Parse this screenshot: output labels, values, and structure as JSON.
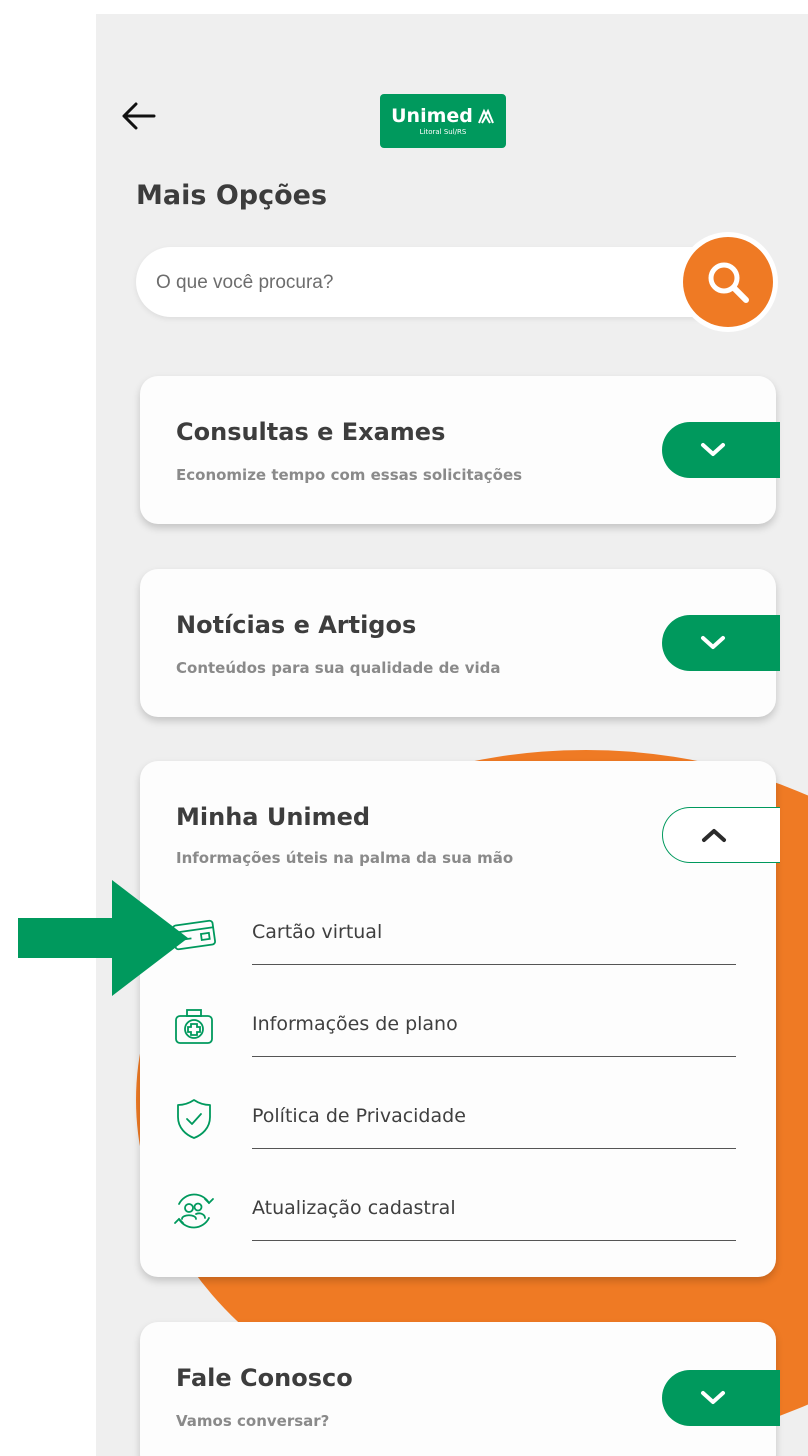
{
  "header": {
    "back_icon": "arrow-left-icon",
    "logo": {
      "name": "Unimed",
      "subtitle": "Litoral Sul/RS",
      "color": "#00995d"
    },
    "title": "Mais Opções"
  },
  "search": {
    "placeholder": "O que você procura?",
    "button_icon": "search-icon",
    "button_color": "#ef7a24"
  },
  "cards": [
    {
      "title": "Consultas e Exames",
      "subtitle": "Economize tempo com essas solicitações",
      "expanded": false,
      "toggle_icon": "chevron-down-icon"
    },
    {
      "title": "Notícias e Artigos",
      "subtitle": "Conteúdos para sua qualidade de vida",
      "expanded": false,
      "toggle_icon": "chevron-down-icon"
    },
    {
      "title": "Minha Unimed",
      "subtitle": "Informações úteis na palma da sua mão",
      "expanded": true,
      "toggle_icon": "chevron-up-icon",
      "items": [
        {
          "label": "Cartão virtual",
          "icon": "card-icon"
        },
        {
          "label": "Informações de plano",
          "icon": "medical-kit-icon"
        },
        {
          "label": "Política de Privacidade",
          "icon": "shield-check-icon"
        },
        {
          "label": "Atualização cadastral",
          "icon": "user-refresh-icon"
        }
      ]
    },
    {
      "title": "Fale Conosco",
      "subtitle": "Vamos conversar?",
      "expanded": false,
      "toggle_icon": "chevron-down-icon"
    }
  ],
  "annotation": {
    "icon": "pointer-arrow-icon",
    "color": "#00995d"
  },
  "colors": {
    "brand_green": "#00995d",
    "accent_orange": "#ef7a24",
    "background": "#efefef"
  }
}
